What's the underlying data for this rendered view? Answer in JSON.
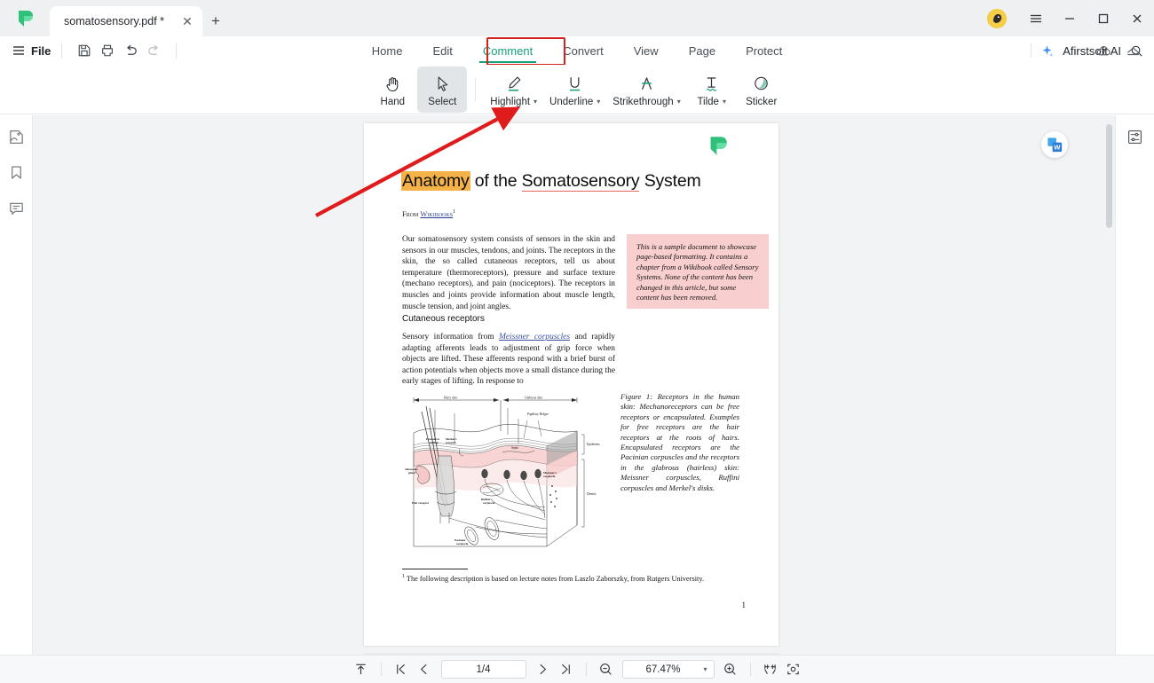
{
  "window": {
    "app_logo": "afirstsoft-logo",
    "tab_title": "somatosensory.pdf *",
    "close_tab_glyph": "✕",
    "new_tab_glyph": "+",
    "minimize_glyph": "—",
    "maximize_glyph": "□",
    "close_glyph": "✕",
    "menu_glyph": "≡"
  },
  "menubar": {
    "file_label": "File",
    "quick_actions": [
      "save-icon",
      "print-icon",
      "undo-icon",
      "redo-icon"
    ]
  },
  "ribbon_tabs": {
    "items": [
      {
        "label": "Home",
        "active": false
      },
      {
        "label": "Edit",
        "active": false
      },
      {
        "label": "Comment",
        "active": true
      },
      {
        "label": "Convert",
        "active": false
      },
      {
        "label": "View",
        "active": false
      },
      {
        "label": "Page",
        "active": false
      },
      {
        "label": "Protect",
        "active": false
      }
    ],
    "ai_label": "Afirstsoft AI",
    "search_icon": "search-icon",
    "highlight_box_color": "#d2231f",
    "active_tab_color": "#16a07a"
  },
  "right_float": {
    "cloud_icon": "cloud-upload-icon",
    "collapse_icon": "collapse-ribbon-icon"
  },
  "toolbar": {
    "tools": [
      {
        "name": "hand",
        "label": "Hand",
        "caret": false,
        "selected": false
      },
      {
        "name": "select",
        "label": "Select",
        "caret": false,
        "selected": true
      },
      {
        "name": "highlight",
        "label": "Highlight",
        "caret": true,
        "selected": false
      },
      {
        "name": "underline",
        "label": "Underline",
        "caret": true,
        "selected": false
      },
      {
        "name": "strikethrough",
        "label": "Strikethrough",
        "caret": true,
        "selected": false
      },
      {
        "name": "tilde",
        "label": "Tilde",
        "caret": true,
        "selected": false
      },
      {
        "name": "sticker",
        "label": "Sticker",
        "caret": false,
        "selected": false
      }
    ],
    "caret_glyph": "▾"
  },
  "left_rail": {
    "items": [
      "thumbnail-icon",
      "bookmark-icon",
      "comment-icon"
    ]
  },
  "right_rail": {
    "items": [
      "properties-panel-icon"
    ]
  },
  "document": {
    "title_highlighted": "Anatomy",
    "title_rest_a": " of the ",
    "title_underlined": "Somatosensory",
    "title_rest_b": " System",
    "from_prefix": "From ",
    "from_link": "Wikibooks",
    "from_sup": "1",
    "paragraph1": "Our somatosensory system consists of sensors in the skin and sensors in our muscles, tendons, and joints. The receptors in the skin, the so called cutaneous receptors, tell us about temperature (thermoreceptors), pressure and surface texture (mechano receptors), and pain (nociceptors). The receptors in muscles and joints provide information about muscle length, muscle tension, and joint angles.",
    "note_box": "This is a sample document to showcase page-based formatting. It contains a chapter from a Wikibook called Sensory Systems. None of the content has been changed in this article, but some content has been removed.",
    "note_box_color": "#f8cfce",
    "section_heading": "Cutaneous receptors",
    "paragraph2_a": "Sensory information from ",
    "paragraph2_link": "Meissner corpuscles",
    "paragraph2_b": " and rapidly adapting afferents leads to adjustment of grip force when objects are lifted. These afferents respond with a brief burst of action potentials when objects move a small distance during the early stages of lifting. In response to",
    "figure_caption": "Figure 1: Receptors in the human skin: Mechanoreceptors can be free receptors or encapsulated. Examples for free receptors are the hair receptors at the roots of hairs. Encapsulated receptors are the Pacinian corpuscles and the receptors in the glabrous (hairless) skin: Meissner corpuscles, Ruffini corpuscles and Merkel's disks.",
    "footnote_marker": "1",
    "footnote_text": " The following description is based on lecture notes from Laszlo Zaborszky, from Rutgers University.",
    "page_number": "1",
    "figure_labels": {
      "hairy_skin": "Hairy skin",
      "glabrous_skin": "Glabrous skin",
      "epidermis": "Epidermis",
      "dermis": "Dermis",
      "papillary_ridges": "Papillary Ridges",
      "septa": "Septa",
      "free_nerve_ending": "Free nerve ending",
      "merkels_receptor": "Merkel's receptor",
      "meissners_corpuscle": "Meissner's corpuscle",
      "ruffinis_corpuscle": "Ruffini's corpuscle",
      "pacinian_corpuscle": "Pacinian corpuscle",
      "hair_receptor": "Hair receptor",
      "sebaceous_gland": "Sebaceous gland"
    },
    "highlight_color": "#f5b248",
    "underline_color": "#e8635c"
  },
  "overlay": {
    "arrow_color": "#e01b1b",
    "arrow_target": "highlight-tool"
  },
  "convert_badge": {
    "name": "convert-to-word-icon"
  },
  "statusbar": {
    "fit_top_icon": "scroll-to-top-icon",
    "first_page_icon": "first-page-icon",
    "prev_page_icon": "previous-page-icon",
    "page_value": "1/4",
    "next_page_icon": "next-page-icon",
    "last_page_icon": "last-page-icon",
    "zoom_out_icon": "zoom-out-icon",
    "zoom_value": "67.47%",
    "zoom_caret": "▾",
    "zoom_in_icon": "zoom-in-icon",
    "fit_width_icon": "fit-width-icon",
    "fit_page_icon": "fit-page-icon"
  }
}
